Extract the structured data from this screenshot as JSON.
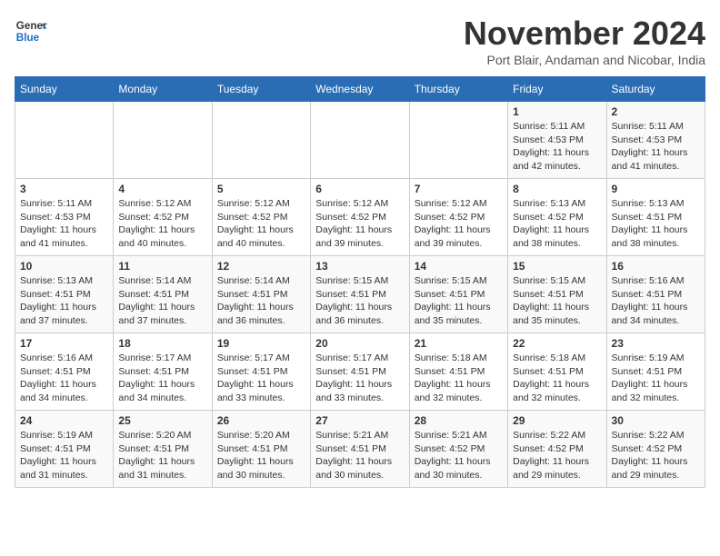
{
  "header": {
    "logo_general": "General",
    "logo_blue": "Blue",
    "month_year": "November 2024",
    "location": "Port Blair, Andaman and Nicobar, India"
  },
  "weekdays": [
    "Sunday",
    "Monday",
    "Tuesday",
    "Wednesday",
    "Thursday",
    "Friday",
    "Saturday"
  ],
  "weeks": [
    [
      {
        "day": "",
        "info": ""
      },
      {
        "day": "",
        "info": ""
      },
      {
        "day": "",
        "info": ""
      },
      {
        "day": "",
        "info": ""
      },
      {
        "day": "",
        "info": ""
      },
      {
        "day": "1",
        "info": "Sunrise: 5:11 AM\nSunset: 4:53 PM\nDaylight: 11 hours\nand 42 minutes."
      },
      {
        "day": "2",
        "info": "Sunrise: 5:11 AM\nSunset: 4:53 PM\nDaylight: 11 hours\nand 41 minutes."
      }
    ],
    [
      {
        "day": "3",
        "info": "Sunrise: 5:11 AM\nSunset: 4:53 PM\nDaylight: 11 hours\nand 41 minutes."
      },
      {
        "day": "4",
        "info": "Sunrise: 5:12 AM\nSunset: 4:52 PM\nDaylight: 11 hours\nand 40 minutes."
      },
      {
        "day": "5",
        "info": "Sunrise: 5:12 AM\nSunset: 4:52 PM\nDaylight: 11 hours\nand 40 minutes."
      },
      {
        "day": "6",
        "info": "Sunrise: 5:12 AM\nSunset: 4:52 PM\nDaylight: 11 hours\nand 39 minutes."
      },
      {
        "day": "7",
        "info": "Sunrise: 5:12 AM\nSunset: 4:52 PM\nDaylight: 11 hours\nand 39 minutes."
      },
      {
        "day": "8",
        "info": "Sunrise: 5:13 AM\nSunset: 4:52 PM\nDaylight: 11 hours\nand 38 minutes."
      },
      {
        "day": "9",
        "info": "Sunrise: 5:13 AM\nSunset: 4:51 PM\nDaylight: 11 hours\nand 38 minutes."
      }
    ],
    [
      {
        "day": "10",
        "info": "Sunrise: 5:13 AM\nSunset: 4:51 PM\nDaylight: 11 hours\nand 37 minutes."
      },
      {
        "day": "11",
        "info": "Sunrise: 5:14 AM\nSunset: 4:51 PM\nDaylight: 11 hours\nand 37 minutes."
      },
      {
        "day": "12",
        "info": "Sunrise: 5:14 AM\nSunset: 4:51 PM\nDaylight: 11 hours\nand 36 minutes."
      },
      {
        "day": "13",
        "info": "Sunrise: 5:15 AM\nSunset: 4:51 PM\nDaylight: 11 hours\nand 36 minutes."
      },
      {
        "day": "14",
        "info": "Sunrise: 5:15 AM\nSunset: 4:51 PM\nDaylight: 11 hours\nand 35 minutes."
      },
      {
        "day": "15",
        "info": "Sunrise: 5:15 AM\nSunset: 4:51 PM\nDaylight: 11 hours\nand 35 minutes."
      },
      {
        "day": "16",
        "info": "Sunrise: 5:16 AM\nSunset: 4:51 PM\nDaylight: 11 hours\nand 34 minutes."
      }
    ],
    [
      {
        "day": "17",
        "info": "Sunrise: 5:16 AM\nSunset: 4:51 PM\nDaylight: 11 hours\nand 34 minutes."
      },
      {
        "day": "18",
        "info": "Sunrise: 5:17 AM\nSunset: 4:51 PM\nDaylight: 11 hours\nand 34 minutes."
      },
      {
        "day": "19",
        "info": "Sunrise: 5:17 AM\nSunset: 4:51 PM\nDaylight: 11 hours\nand 33 minutes."
      },
      {
        "day": "20",
        "info": "Sunrise: 5:17 AM\nSunset: 4:51 PM\nDaylight: 11 hours\nand 33 minutes."
      },
      {
        "day": "21",
        "info": "Sunrise: 5:18 AM\nSunset: 4:51 PM\nDaylight: 11 hours\nand 32 minutes."
      },
      {
        "day": "22",
        "info": "Sunrise: 5:18 AM\nSunset: 4:51 PM\nDaylight: 11 hours\nand 32 minutes."
      },
      {
        "day": "23",
        "info": "Sunrise: 5:19 AM\nSunset: 4:51 PM\nDaylight: 11 hours\nand 32 minutes."
      }
    ],
    [
      {
        "day": "24",
        "info": "Sunrise: 5:19 AM\nSunset: 4:51 PM\nDaylight: 11 hours\nand 31 minutes."
      },
      {
        "day": "25",
        "info": "Sunrise: 5:20 AM\nSunset: 4:51 PM\nDaylight: 11 hours\nand 31 minutes."
      },
      {
        "day": "26",
        "info": "Sunrise: 5:20 AM\nSunset: 4:51 PM\nDaylight: 11 hours\nand 30 minutes."
      },
      {
        "day": "27",
        "info": "Sunrise: 5:21 AM\nSunset: 4:51 PM\nDaylight: 11 hours\nand 30 minutes."
      },
      {
        "day": "28",
        "info": "Sunrise: 5:21 AM\nSunset: 4:52 PM\nDaylight: 11 hours\nand 30 minutes."
      },
      {
        "day": "29",
        "info": "Sunrise: 5:22 AM\nSunset: 4:52 PM\nDaylight: 11 hours\nand 29 minutes."
      },
      {
        "day": "30",
        "info": "Sunrise: 5:22 AM\nSunset: 4:52 PM\nDaylight: 11 hours\nand 29 minutes."
      }
    ]
  ]
}
